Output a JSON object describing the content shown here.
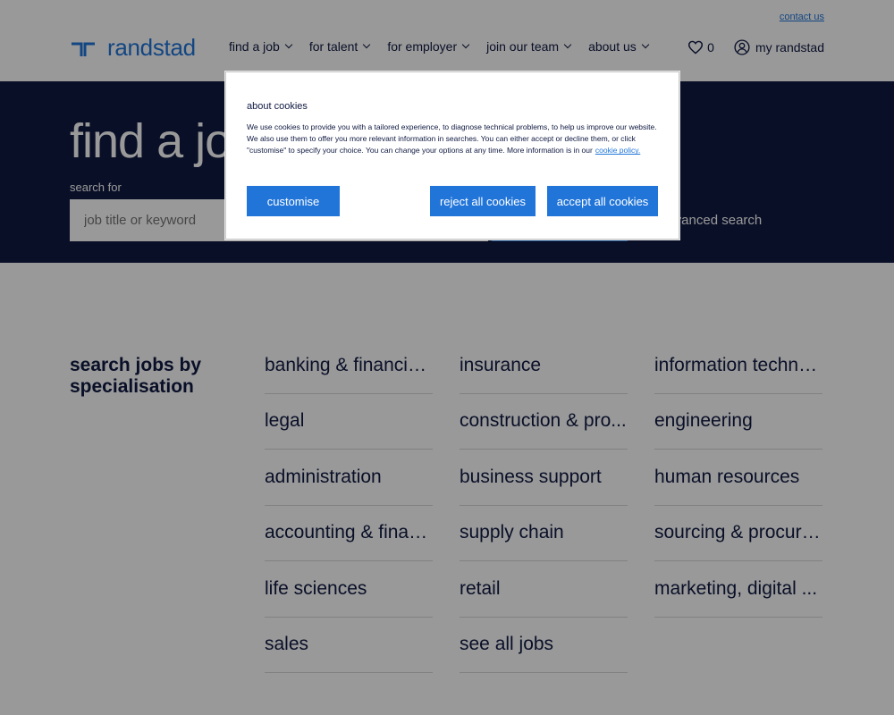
{
  "header": {
    "contact_label": "contact us",
    "logo_text": "randstad",
    "nav": [
      {
        "label": "find a job"
      },
      {
        "label": "for talent"
      },
      {
        "label": "for employer"
      },
      {
        "label": "join our team"
      },
      {
        "label": "about us"
      }
    ],
    "favorites_count": "0",
    "account_label": "my randstad"
  },
  "hero": {
    "title": "find a job",
    "search_label": "search for",
    "search_placeholder": "job title or keyword",
    "advanced_search_label": "advanced search"
  },
  "specialisations": {
    "heading": "search jobs by specialisation",
    "items": [
      "banking & financial...",
      "insurance",
      "information techno...",
      "legal",
      "construction & pro...",
      "engineering",
      "administration",
      "business support",
      "human resources",
      "accounting & finan...",
      "supply chain",
      "sourcing & procure...",
      "life sciences",
      "retail",
      "marketing, digital ...",
      "sales",
      "see all jobs"
    ]
  },
  "cookie_dialog": {
    "title": "about cookies",
    "body": "We use cookies to provide you with a tailored experience, to diagnose technical problems, to help us improve our website. We also use them to offer you more relevant information in searches. You can either accept or decline them, or click \"customise\" to specify your choice. You can change your options at any time. More information is in our",
    "link_label": "cookie policy.",
    "customise_label": "customise",
    "reject_label": "reject all cookies",
    "accept_label": "accept all cookies"
  },
  "colors": {
    "brand_blue": "#2175d9",
    "navy": "#0f1941"
  }
}
